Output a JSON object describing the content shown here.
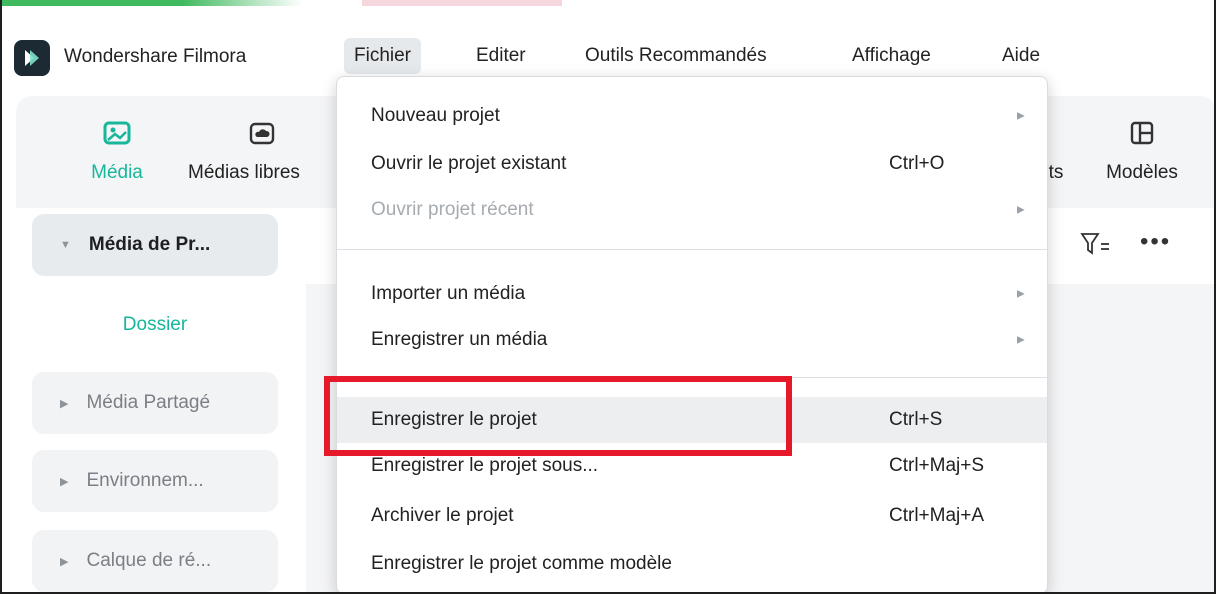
{
  "app": {
    "title": "Wondershare Filmora"
  },
  "menubar": {
    "items": [
      {
        "label": "Fichier"
      },
      {
        "label": "Editer"
      },
      {
        "label": "Outils Recommandés"
      },
      {
        "label": "Affichage"
      },
      {
        "label": "Aide"
      }
    ]
  },
  "toolbar": {
    "items": [
      {
        "label": "Média",
        "icon": "media-icon"
      },
      {
        "label": "Médias libres",
        "icon": "cloud-folder-icon"
      },
      {
        "label": "ts",
        "icon": ""
      },
      {
        "label": "Modèles",
        "icon": "templates-icon"
      }
    ]
  },
  "sidebar": {
    "project_media": "Média de Pr...",
    "folder": "Dossier",
    "shared_media": "Média Partagé",
    "environment": "Environnem...",
    "adjustment_layer": "Calque de ré..."
  },
  "file_menu": {
    "items": [
      {
        "label": "Nouveau projet",
        "shortcut": "",
        "submenu": true
      },
      {
        "label": "Ouvrir le projet existant",
        "shortcut": "Ctrl+O",
        "submenu": false
      },
      {
        "label": "Ouvrir projet récent",
        "shortcut": "",
        "submenu": true,
        "disabled": true
      },
      {
        "label": "Importer un média",
        "shortcut": "",
        "submenu": true
      },
      {
        "label": "Enregistrer un média",
        "shortcut": "",
        "submenu": true
      },
      {
        "label": "Enregistrer le projet",
        "shortcut": "Ctrl+S",
        "submenu": false,
        "highlighted": true
      },
      {
        "label": "Enregistrer le projet sous...",
        "shortcut": "Ctrl+Maj+S",
        "submenu": false
      },
      {
        "label": "Archiver le projet",
        "shortcut": "Ctrl+Maj+A",
        "submenu": false
      },
      {
        "label": "Enregistrer le projet comme modèle",
        "shortcut": "",
        "submenu": false
      }
    ]
  },
  "colors": {
    "accent": "#16b79a",
    "highlight_box": "#e5192a"
  }
}
